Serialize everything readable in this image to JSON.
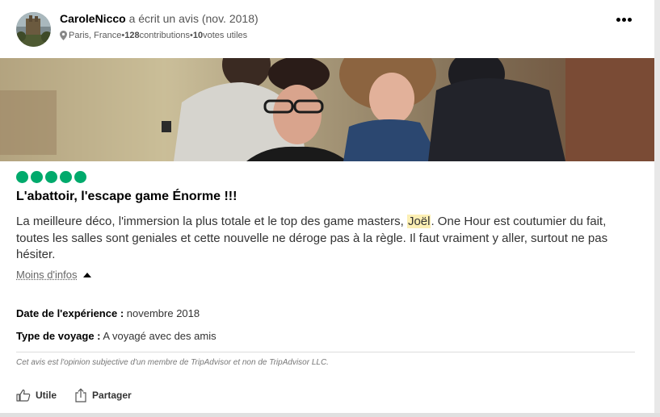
{
  "review": {
    "author": {
      "username": "CaroleNicco",
      "action_text": " a écrit un avis (nov. 2018)",
      "location": "Paris, France",
      "separator": " • ",
      "contributions_count": "128",
      "contributions_label": " contributions",
      "votes_count": "10",
      "votes_label": " votes utiles"
    },
    "menu_icon": "more-horizontal-icon",
    "rating": {
      "bubbles": 5,
      "max": 5,
      "color": "#00aa6c"
    },
    "title": "L'abattoir, l'escape game Énorme !!!",
    "body": {
      "part1": "La meilleure déco, l'immersion la plus totale et le top des game masters, ",
      "highlight": "Joël",
      "part2": ". One Hour est coutumier du fait, toutes les salles sont geniales et cette nouvelle ne déroge pas à la règle. Il faut vraiment y aller, surtout ne pas hésiter.",
      "highlight_color": "#fcefb4"
    },
    "toggle_label": "Moins d'infos",
    "details": {
      "date_label": "Date de l'expérience :",
      "date_value": " novembre 2018",
      "trip_label": "Type de voyage :",
      "trip_value": " A voyagé avec des amis"
    },
    "disclaimer": "Cet avis est l'opinion subjective d'un membre de TripAdvisor et non de TripAdvisor LLC.",
    "actions": {
      "helpful_label": "Utile",
      "share_label": "Partager"
    }
  }
}
